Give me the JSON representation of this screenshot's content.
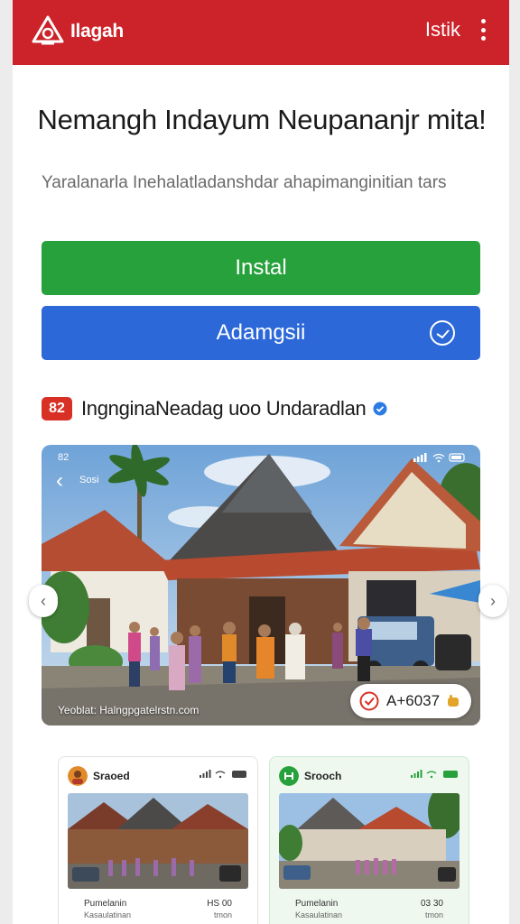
{
  "header": {
    "brand": "Ilagah",
    "link": "Istik",
    "brand_color": "#cc2229"
  },
  "hero_text": {
    "title": "Nemangh Indayum Neupananjr mita!",
    "subtitle": "Yaralanarla Inehalatladanshdar ahapimanginitian tars"
  },
  "buttons": {
    "primary": "Instal",
    "secondary": "Adamgsii",
    "primary_color": "#26a13b",
    "secondary_color": "#2c68d8"
  },
  "app": {
    "badge": "82",
    "name": "IngnginaNeadag uoo Undaradlan",
    "verified_icon": "verified-check-icon"
  },
  "gallery": {
    "status_left": "82",
    "back_label": "Sosi",
    "caption": "Yeoblat: Halngpgatelrstn.com",
    "chip_text": "A+6037"
  },
  "cards": [
    {
      "title": "Sraoed",
      "footer_left_top": "Pumelanin",
      "footer_left_bottom": "Kasaulatinan",
      "footer_right_top": "HS 00",
      "footer_right_bottom": "tmon"
    },
    {
      "title": "Srooch",
      "footer_left_top": "Pumelanin",
      "footer_left_bottom": "Kasaulatinan",
      "footer_right_top": "03 30",
      "footer_right_bottom": "tmon"
    }
  ]
}
